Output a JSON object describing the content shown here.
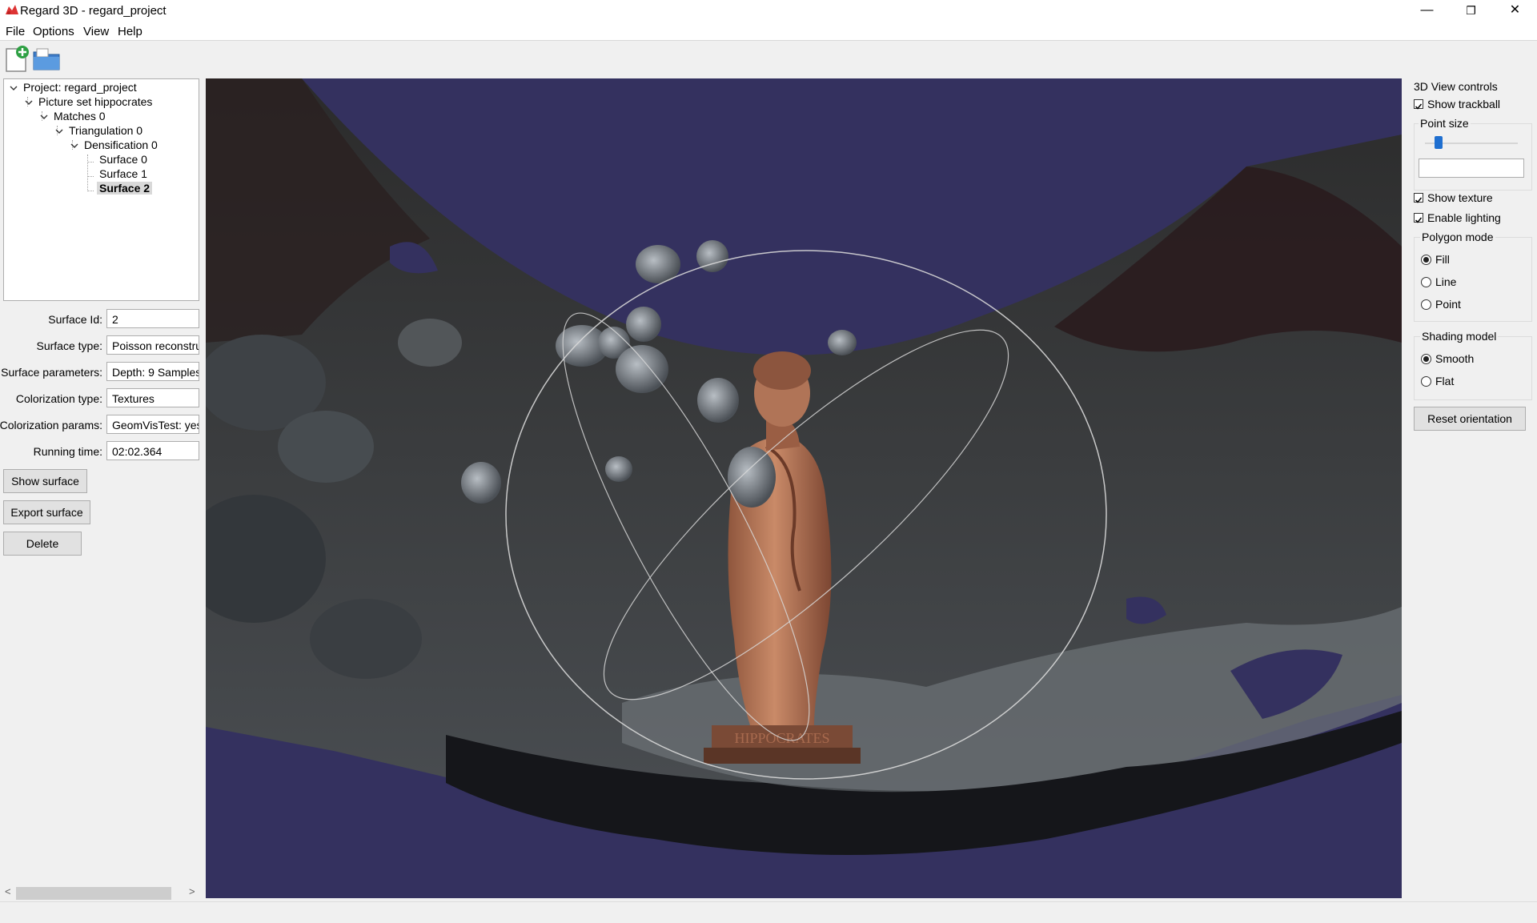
{
  "window": {
    "title": "Regard 3D - regard_project",
    "minimize": "—",
    "restore": "❐",
    "close": "✕"
  },
  "menu": [
    "File",
    "Options",
    "View",
    "Help"
  ],
  "tree": {
    "nodes": [
      {
        "label": "Project: regard_project",
        "level": 0
      },
      {
        "label": "Picture set hippocrates",
        "level": 1
      },
      {
        "label": "Matches 0",
        "level": 2
      },
      {
        "label": "Triangulation 0",
        "level": 3
      },
      {
        "label": "Densification 0",
        "level": 4
      },
      {
        "label": "Surface 0",
        "level": 5
      },
      {
        "label": "Surface 1",
        "level": 5
      },
      {
        "label": "Surface 2",
        "level": 5,
        "selected": true
      }
    ]
  },
  "properties": [
    {
      "label": "Surface Id:",
      "value": "2"
    },
    {
      "label": "Surface type:",
      "value": "Poisson reconstruction"
    },
    {
      "label": "Surface parameters:",
      "value": "Depth: 9 Samples"
    },
    {
      "label": "Colorization type:",
      "value": "Textures"
    },
    {
      "label": "Colorization params:",
      "value": "GeomVisTest: yes"
    },
    {
      "label": "Running time:",
      "value": "02:02.364"
    }
  ],
  "buttons": {
    "show_surface": "Show surface",
    "export_surface": "Export surface",
    "delete": "Delete"
  },
  "view_controls": {
    "title": "3D View controls",
    "show_trackball": {
      "label": "Show trackball",
      "checked": true
    },
    "point_size": {
      "label": "Point size",
      "value": 0.12,
      "text": ""
    },
    "show_texture": {
      "label": "Show texture",
      "checked": true
    },
    "enable_lighting": {
      "label": "Enable lighting",
      "checked": true
    },
    "polygon_mode": {
      "title": "Polygon mode",
      "options": [
        "Fill",
        "Line",
        "Point"
      ],
      "selected": "Fill"
    },
    "shading_model": {
      "title": "Shading model",
      "options": [
        "Smooth",
        "Flat"
      ],
      "selected": "Smooth"
    },
    "reset_orientation": "Reset orientation"
  },
  "scene": {
    "background_color": "#34315f",
    "plinth_text": "HIPPOCRATES"
  }
}
